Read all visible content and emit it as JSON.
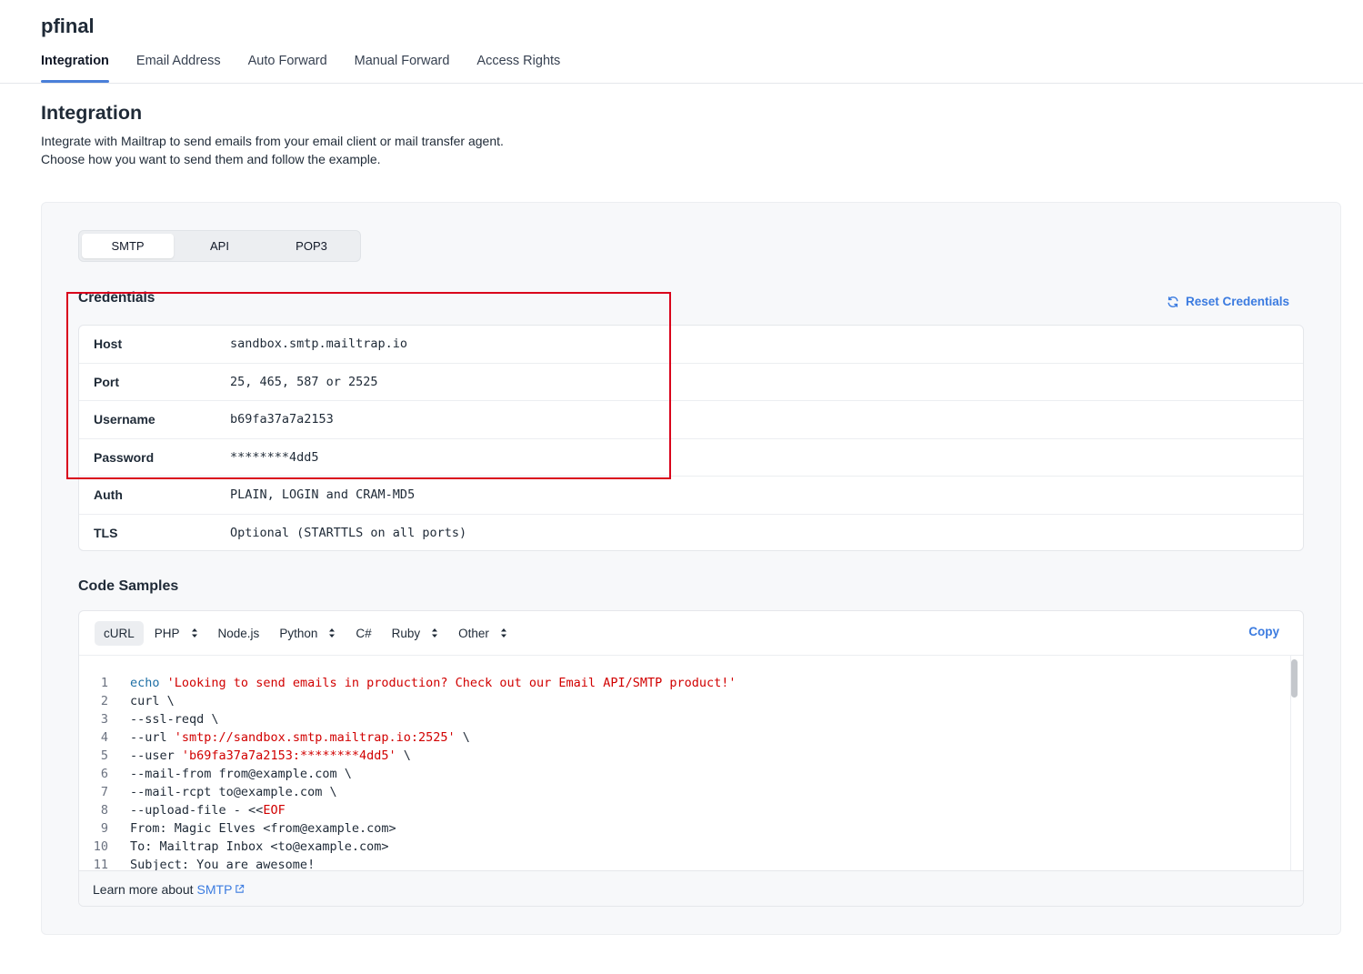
{
  "header": {
    "inbox_name": "pfinal",
    "tabs": [
      {
        "label": "Integration",
        "active": true
      },
      {
        "label": "Email Address"
      },
      {
        "label": "Auto Forward"
      },
      {
        "label": "Manual Forward"
      },
      {
        "label": "Access Rights"
      }
    ]
  },
  "main": {
    "title": "Integration",
    "description_line1": "Integrate with Mailtrap to send emails from your email client or mail transfer agent.",
    "description_line2": "Choose how you want to send them and follow the example."
  },
  "protocol_tabs": [
    {
      "label": "SMTP",
      "active": true
    },
    {
      "label": "API"
    },
    {
      "label": "POP3"
    }
  ],
  "credentials": {
    "title": "Credentials",
    "reset_label": "Reset Credentials",
    "rows": [
      {
        "key": "Host",
        "value": "sandbox.smtp.mailtrap.io"
      },
      {
        "key": "Port",
        "value": "25, 465, 587 or 2525"
      },
      {
        "key": "Username",
        "value": "b69fa37a7a2153"
      },
      {
        "key": "Password",
        "value": "********4dd5"
      },
      {
        "key": "Auth",
        "value": "PLAIN, LOGIN and CRAM-MD5"
      },
      {
        "key": "TLS",
        "value": "Optional (STARTTLS on all ports)"
      }
    ]
  },
  "code_samples": {
    "title": "Code Samples",
    "languages": [
      {
        "label": "cURL",
        "active": true,
        "dropdown": false
      },
      {
        "label": "PHP",
        "dropdown": true
      },
      {
        "label": "Node.js",
        "dropdown": false
      },
      {
        "label": "Python",
        "dropdown": true
      },
      {
        "label": "C#",
        "dropdown": false
      },
      {
        "label": "Ruby",
        "dropdown": true
      },
      {
        "label": "Other",
        "dropdown": true
      }
    ],
    "copy_label": "Copy",
    "lines": [
      {
        "n": "1",
        "parts": [
          {
            "t": "echo",
            "c": "kw"
          },
          {
            "t": " "
          },
          {
            "t": "'Looking to send emails in production? Check out our Email API/SMTP product!'",
            "c": "str"
          }
        ]
      },
      {
        "n": "2",
        "parts": [
          {
            "t": "curl \\"
          }
        ]
      },
      {
        "n": "3",
        "parts": [
          {
            "t": "--ssl-reqd \\"
          }
        ]
      },
      {
        "n": "4",
        "parts": [
          {
            "t": "--url "
          },
          {
            "t": "'smtp://sandbox.smtp.mailtrap.io:2525'",
            "c": "str"
          },
          {
            "t": " \\"
          }
        ]
      },
      {
        "n": "5",
        "parts": [
          {
            "t": "--user "
          },
          {
            "t": "'b69fa37a7a2153:********4dd5'",
            "c": "str"
          },
          {
            "t": " \\"
          }
        ]
      },
      {
        "n": "6",
        "parts": [
          {
            "t": "--mail-from from@example.com \\"
          }
        ]
      },
      {
        "n": "7",
        "parts": [
          {
            "t": "--mail-rcpt to@example.com \\"
          }
        ]
      },
      {
        "n": "8",
        "parts": [
          {
            "t": "--upload-file - <<"
          },
          {
            "t": "EOF",
            "c": "str"
          }
        ]
      },
      {
        "n": "9",
        "parts": [
          {
            "t": "From: Magic Elves <from@example.com>"
          }
        ]
      },
      {
        "n": "10",
        "parts": [
          {
            "t": "To: Mailtrap Inbox <to@example.com>"
          }
        ]
      },
      {
        "n": "11",
        "parts": [
          {
            "t": "Subject: You are awesome!"
          }
        ]
      }
    ],
    "footer_text": "Learn more about",
    "footer_link": "SMTP"
  },
  "colors": {
    "accent": "#3b7be0",
    "highlight_box": "#d9001b",
    "string": "#d10000",
    "keyword": "#1d6fa5"
  }
}
